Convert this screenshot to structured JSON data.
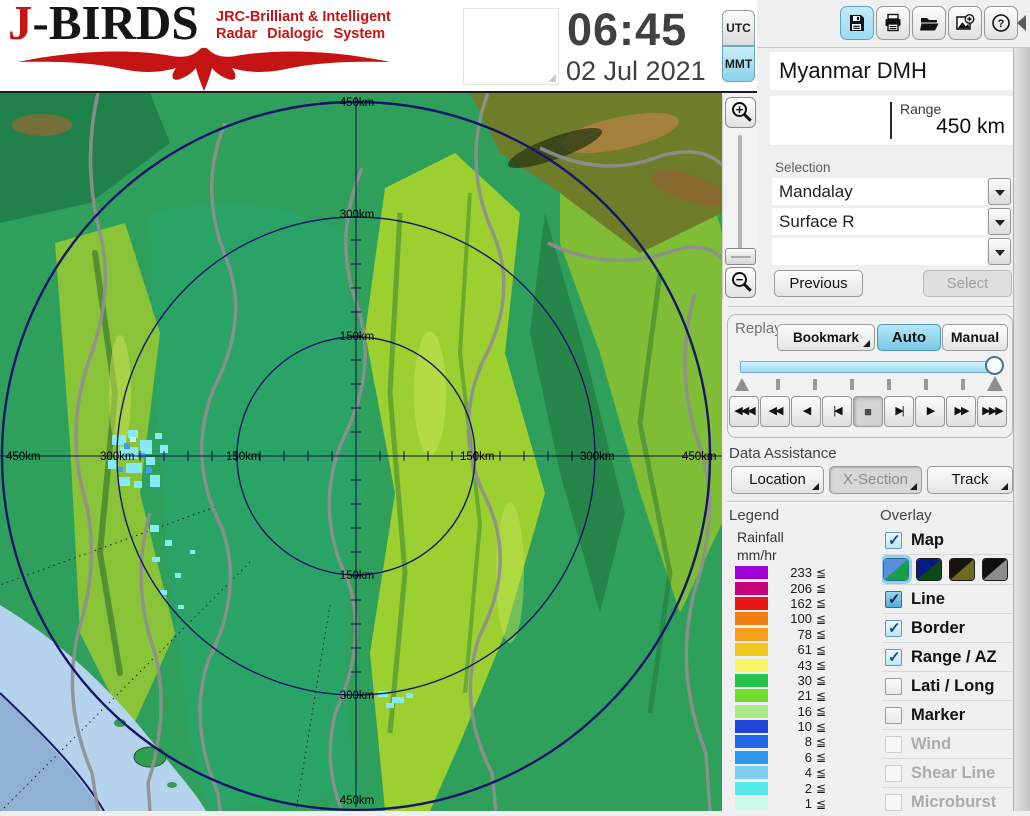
{
  "app": {
    "name_first_letter": "J",
    "name_rest": "-BIRDS",
    "tagline_line1": "JRC-Brilliant & Intelligent",
    "tagline_line2": "Radar Dialogic System"
  },
  "clock": {
    "time": "06:45",
    "date": "02 Jul 2021"
  },
  "timezone": {
    "utc_label": "UTC",
    "mmt_label": "MMT",
    "selected": "MMT"
  },
  "toolbar": {
    "icons": [
      "save",
      "print",
      "open",
      "add-image",
      "help"
    ],
    "highlighted": "save"
  },
  "station": {
    "name": "Myanmar DMH",
    "range_label": "Range",
    "range_value": "450 km"
  },
  "selection": {
    "label": "Selection",
    "dropdowns": [
      {
        "value": "Mandalay"
      },
      {
        "value": "Surface R"
      },
      {
        "value": ""
      }
    ],
    "previous_label": "Previous",
    "select_label": "Select"
  },
  "replay": {
    "label": "Replay",
    "bookmark_label": "Bookmark",
    "auto_label": "Auto",
    "manual_label": "Manual",
    "mode_selected": "Auto",
    "playback": [
      {
        "name": "rewind-fast",
        "glyph": "◀◀◀"
      },
      {
        "name": "rewind",
        "glyph": "◀◀"
      },
      {
        "name": "play-reverse",
        "glyph": "◀"
      },
      {
        "name": "step-back",
        "glyph": "|◀"
      },
      {
        "name": "stop",
        "glyph": "■",
        "active": true
      },
      {
        "name": "step-forward",
        "glyph": "▶|"
      },
      {
        "name": "play",
        "glyph": "▶"
      },
      {
        "name": "forward",
        "glyph": "▶▶"
      },
      {
        "name": "forward-fast",
        "glyph": "▶▶▶"
      }
    ]
  },
  "data_assistance": {
    "label": "Data Assistance",
    "buttons": [
      {
        "label": "Location",
        "enabled": true
      },
      {
        "label": "X-Section",
        "enabled": false
      },
      {
        "label": "Track",
        "enabled": true
      }
    ]
  },
  "legend": {
    "label": "Legend",
    "title": "Rainfall",
    "unit": "mm/hr",
    "suffix": "≦",
    "entries": [
      {
        "value": "233",
        "color": "#a100d4"
      },
      {
        "value": "206",
        "color": "#c9007e"
      },
      {
        "value": "162",
        "color": "#e61717"
      },
      {
        "value": "100",
        "color": "#f07d0e"
      },
      {
        "value": "78",
        "color": "#f5a018"
      },
      {
        "value": "61",
        "color": "#f2c81e"
      },
      {
        "value": "43",
        "color": "#f7f765"
      },
      {
        "value": "30",
        "color": "#28c24e"
      },
      {
        "value": "21",
        "color": "#71dd2b"
      },
      {
        "value": "16",
        "color": "#a9e986"
      },
      {
        "value": "10",
        "color": "#1e46d9"
      },
      {
        "value": "8",
        "color": "#1f66e8"
      },
      {
        "value": "6",
        "color": "#2f96ef"
      },
      {
        "value": "4",
        "color": "#7ccbf2"
      },
      {
        "value": "2",
        "color": "#59e8e8"
      },
      {
        "value": "1",
        "color": "#c9fbe9"
      }
    ]
  },
  "overlay": {
    "label": "Overlay",
    "map_styles": [
      [
        "#5b8ede",
        "#17a046"
      ],
      [
        "#0b1a86",
        "#0b4a12"
      ],
      [
        "#15150a",
        "#6e6a1e"
      ],
      [
        "#101010",
        "#8c8c8c"
      ]
    ],
    "selected_map_style": 0,
    "items": [
      {
        "label": "Map",
        "checked": true,
        "enabled": true
      },
      {
        "label": "Line",
        "checked": true,
        "enabled": true
      },
      {
        "label": "Border",
        "checked": true,
        "enabled": true
      },
      {
        "label": "Range / AZ",
        "checked": true,
        "enabled": true
      },
      {
        "label": "Lati / Long",
        "checked": false,
        "enabled": true
      },
      {
        "label": "Marker",
        "checked": false,
        "enabled": true
      },
      {
        "label": "Wind",
        "checked": false,
        "enabled": false
      },
      {
        "label": "Shear Line",
        "checked": false,
        "enabled": false
      },
      {
        "label": "Microburst",
        "checked": false,
        "enabled": false
      }
    ]
  },
  "map": {
    "rings_km": [
      150,
      300,
      450
    ],
    "labels_vertical": [
      "450km",
      "300km",
      "150km",
      "150km",
      "300km",
      "450km"
    ],
    "labels_horizontal": [
      "450km",
      "300km",
      "150km",
      "150km",
      "300km",
      "450km"
    ]
  },
  "zoom_controls": {
    "zoom_in": "+",
    "zoom_out": "−"
  }
}
